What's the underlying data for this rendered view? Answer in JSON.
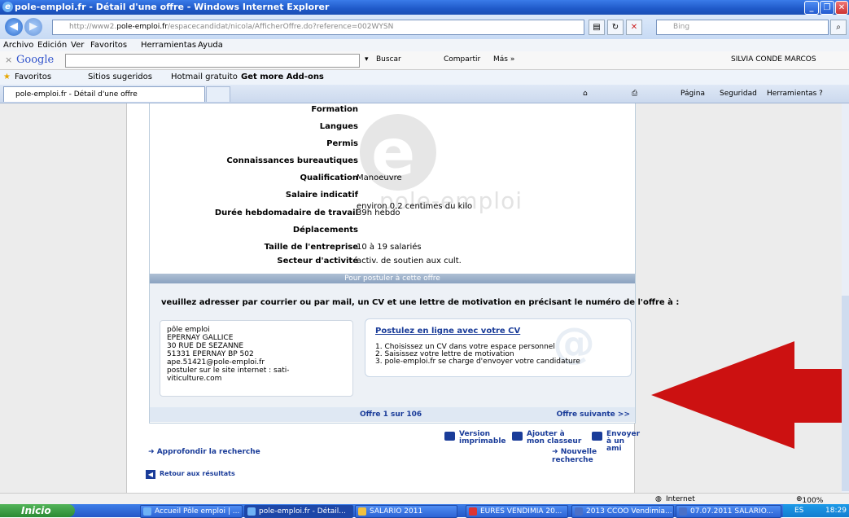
{
  "window": {
    "title": "pole-emploi.fr - Détail d'une offre - Windows Internet Explorer"
  },
  "address": {
    "url_prefix": "http://www2.",
    "url_domain": "pole-emploi.fr",
    "url_path": "/espacecandidat/nicola/AfficherOffre.do?reference=002WYSN",
    "search_placeholder": "Bing"
  },
  "menu": [
    "Archivo",
    "Edición",
    "Ver",
    "Favoritos",
    "Herramientas",
    "Ayuda"
  ],
  "google_bar": {
    "logo": "Google",
    "buscar": "Buscar",
    "compartir": "Compartir",
    "mas": "Más »",
    "user": "SILVIA CONDE MARCOS"
  },
  "favorites_bar": {
    "favoritos": "Favoritos",
    "sitios": "Sitios sugeridos",
    "hotmail": "Hotmail gratuito",
    "addons": "Get more Add-ons"
  },
  "tab": {
    "label": "pole-emploi.fr - Détail d'une offre"
  },
  "command_bar": {
    "pagina": "Página",
    "seguridad": "Seguridad",
    "herramientas": "Herramientas"
  },
  "offer": {
    "fields": [
      {
        "label": "Formation",
        "value": ""
      },
      {
        "label": "Langues",
        "value": ""
      },
      {
        "label": "Permis",
        "value": ""
      },
      {
        "label": "Connaissances bureautiques",
        "value": ""
      },
      {
        "label": "Qualification",
        "value": "Manoeuvre"
      },
      {
        "label": "Salaire indicatif",
        "value": "environ 0,2 centimes du kilo"
      },
      {
        "label": "Durée hebdomadaire de travail",
        "value": "39h hebdo"
      },
      {
        "label": "Déplacements",
        "value": ""
      },
      {
        "label": "Taille de l'entreprise",
        "value": "10 à 19 salariés"
      },
      {
        "label": "Secteur d'activité",
        "value": "activ. de soutien aux cult."
      }
    ],
    "watermark": "pole-emploi",
    "apply_header": "Pour postuler à cette offre",
    "apply_intro": "veuillez adresser par courrier ou par mail, un CV et une lettre de motivation en précisant le numéro de l'offre à :",
    "address_lines": [
      "pôle emploi",
      "EPERNAY GALLICE",
      "30 RUE DE SEZANNE",
      "51331 EPERNAY BP 502",
      "ape.51421@pole-emploi.fr",
      "postuler sur le site internet : sati-",
      "viticulture.com"
    ],
    "online_link": "Postulez en ligne avec votre CV",
    "online_steps": [
      "1. Choisissez un CV dans votre espace personnel",
      "2. Saisissez votre lettre de motivation",
      "3. pole-emploi.fr se charge d'envoyer votre candidature"
    ],
    "pager": {
      "current": "Offre 1 sur 106",
      "next": "Offre suivante >>"
    },
    "actions": {
      "print_1": "Version",
      "print_2": "imprimable",
      "save_1": "Ajouter à",
      "save_2": "mon classeur",
      "send_1": "Envoyer",
      "send_2": "à un ami"
    },
    "links": {
      "approfondir": "Approfondir la recherche",
      "nouvelle": "Nouvelle recherche",
      "retour": "Retour aux résultats"
    }
  },
  "annotation": {
    "arrow_color": "#cc1111"
  },
  "status": {
    "zone": "Internet",
    "zoom": "100%"
  },
  "taskbar": {
    "start": "Inicio",
    "buttons": [
      "Accueil Pôle emploi | ...",
      "pole-emploi.fr - Détail...",
      "SALARIO 2011",
      "EURES VENDIMIA 20...",
      "2013 CCOO Vendimia...",
      "07.07.2011 SALARIO..."
    ],
    "lang": "ES",
    "time": "18:29"
  }
}
